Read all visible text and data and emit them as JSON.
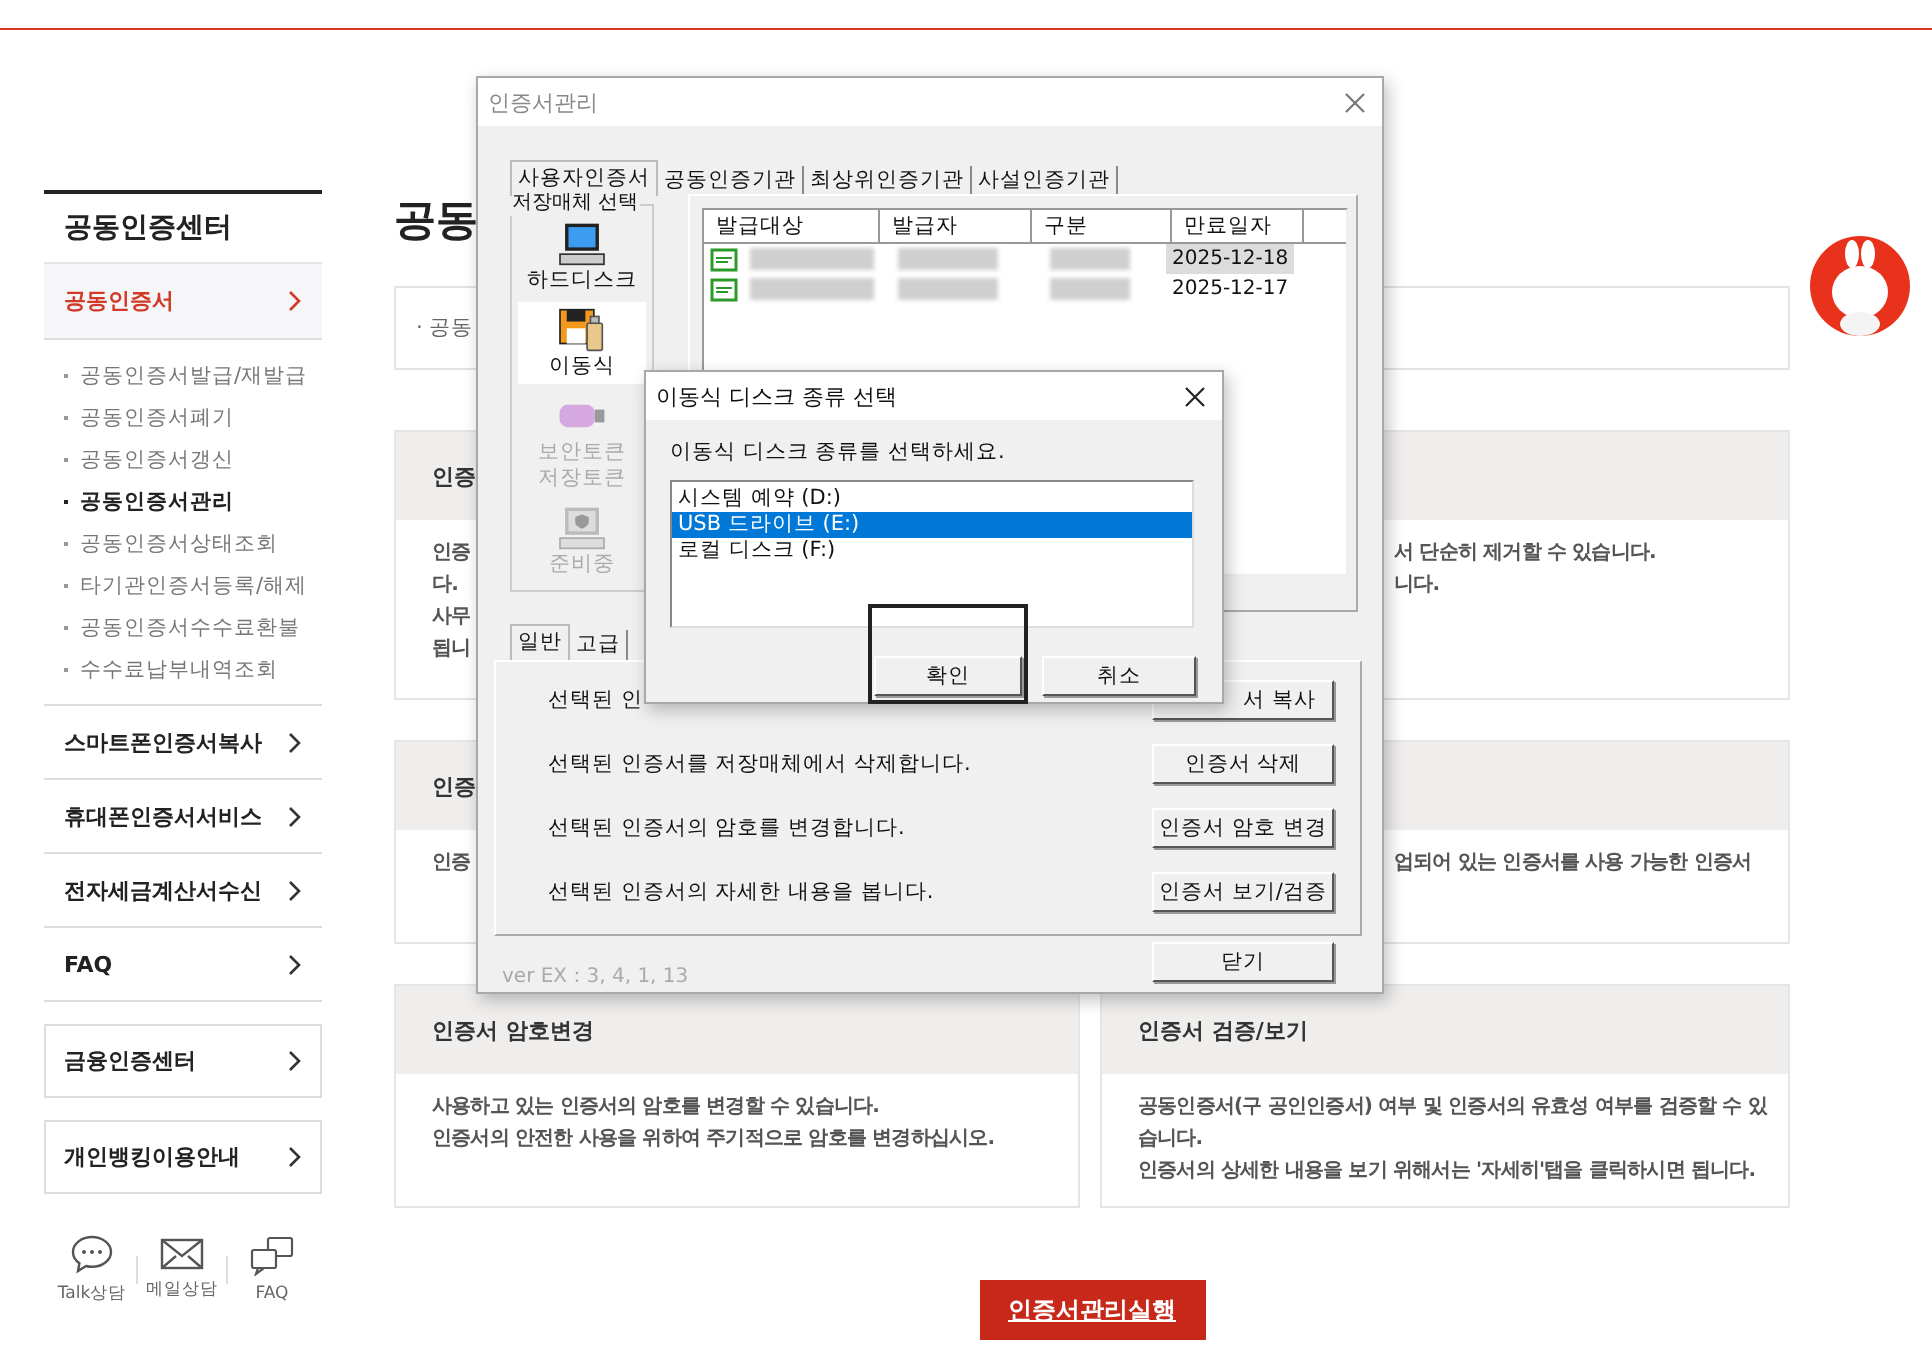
{
  "sidebar": {
    "title": "공동인증센터",
    "sections": [
      {
        "label": "공동인증서",
        "selected": true,
        "children": [
          {
            "label": "공동인증서발급/재발급",
            "selected": false
          },
          {
            "label": "공동인증서폐기",
            "selected": false
          },
          {
            "label": "공동인증서갱신",
            "selected": false
          },
          {
            "label": "공동인증서관리",
            "selected": true
          },
          {
            "label": "공동인증서상태조회",
            "selected": false
          },
          {
            "label": "타기관인증서등록/해제",
            "selected": false
          },
          {
            "label": "공동인증서수수료환불",
            "selected": false
          },
          {
            "label": "수수료납부내역조회",
            "selected": false
          }
        ]
      },
      {
        "label": "스마트폰인증서복사",
        "selected": false
      },
      {
        "label": "휴대폰인증서서비스",
        "selected": false
      },
      {
        "label": "전자세금계산서수신",
        "selected": false
      },
      {
        "label": "FAQ",
        "selected": false
      }
    ],
    "boxed_links": [
      "금융인증센터",
      "개인뱅킹이용안내"
    ],
    "contacts": [
      {
        "kind": "chat",
        "label": "Talk상담"
      },
      {
        "kind": "mail",
        "label": "메일상담"
      },
      {
        "kind": "faq",
        "label": "FAQ"
      }
    ]
  },
  "page": {
    "heading": "공동",
    "notice": "· 공동",
    "cards": [
      {
        "title": "인증",
        "lines": [
          "인증",
          "다.",
          "사무",
          "됩니"
        ]
      },
      {
        "lines": [
          "서 단순히 제거할 수 있습니다.",
          "니다."
        ]
      },
      {
        "title": "인증",
        "lines": [
          "인증"
        ]
      },
      {
        "lines": [
          "업되어 있는 인증서를 사용 가능한 인증서"
        ]
      },
      {
        "title": "인증서 암호변경",
        "lines": [
          "사용하고 있는 인증서의 암호를 변경할 수 있습니다.",
          "인증서의 안전한 사용을 위하여 주기적으로 암호를 변경하십시오."
        ]
      },
      {
        "title": "인증서 검증/보기",
        "lines": [
          "공동인증서(구 공인인증서) 여부 및 인증서의 유효성 여부를 검증할 수 있",
          "습니다.",
          "인증서의 상세한 내용을 보기 위해서는 '자세히'탭을 클릭하시면 됩니다."
        ]
      }
    ],
    "run_button": "인증서관리실행"
  },
  "cert_window": {
    "title": "인증서관리",
    "tabs": [
      {
        "label": "사용자인증서",
        "selected": true
      },
      {
        "label": "공동인증기관",
        "selected": false
      },
      {
        "label": "최상위인증기관",
        "selected": false
      },
      {
        "label": "사설인증기관",
        "selected": false
      }
    ],
    "storage_title": "저장매체 선택",
    "storage": [
      {
        "kind": "harddisk",
        "lines": [
          "하드디스크"
        ],
        "selected": false,
        "disabled": false
      },
      {
        "kind": "removable",
        "lines": [
          "이동식"
        ],
        "selected": true,
        "disabled": false
      },
      {
        "kind": "token",
        "lines": [
          "보안토큰",
          "저장토큰"
        ],
        "selected": false,
        "disabled": true
      },
      {
        "kind": "pending",
        "lines": [
          "준비중"
        ],
        "selected": false,
        "disabled": true
      }
    ],
    "columns": [
      "발급대상",
      "발급자",
      "구분",
      "만료일자"
    ],
    "certs": [
      {
        "expiry": "2025-12-18",
        "selected": true
      },
      {
        "expiry": "2025-12-17",
        "selected": false
      }
    ],
    "sub_tabs": [
      {
        "label": "일반",
        "selected": true
      },
      {
        "label": "고급",
        "selected": false
      }
    ],
    "actions": [
      {
        "description": "선택된 인",
        "button": "서 복사"
      },
      {
        "description": "선택된 인증서를 저장매체에서 삭제합니다.",
        "button": "인증서 삭제"
      },
      {
        "description": "선택된 인증서의 암호를 변경합니다.",
        "button": "인증서 암호 변경"
      },
      {
        "description": "선택된 인증서의 자세한 내용을 봅니다.",
        "button": "인증서 보기/검증"
      }
    ],
    "version": "ver EX : 3, 4, 1, 13",
    "close_button": "닫기"
  },
  "disk_dialog": {
    "title": "이동식 디스크 종류 선택",
    "prompt": "이동식 디스크 종류를 선택하세요.",
    "drives": [
      {
        "label": "시스템 예약 (D:)",
        "selected": false
      },
      {
        "label": "USB 드라이브 (E:)",
        "selected": true
      },
      {
        "label": "로컬 디스크 (F:)",
        "selected": false
      }
    ],
    "buttons": [
      "확인",
      "취소"
    ]
  }
}
